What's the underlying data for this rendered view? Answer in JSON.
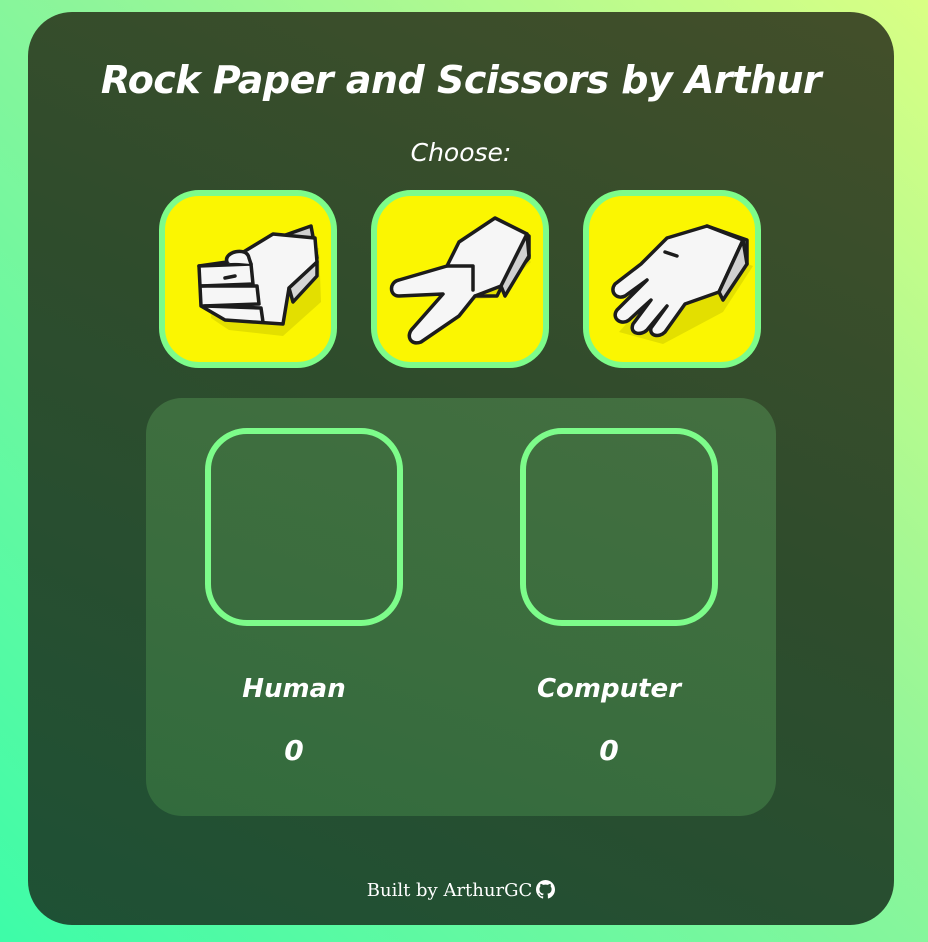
{
  "header": {
    "title": "Rock Paper and Scissors by Arthur",
    "prompt": "Choose:"
  },
  "choices": [
    {
      "id": "rock",
      "icon": "rock-hand-icon"
    },
    {
      "id": "scissors",
      "icon": "scissors-hand-icon"
    },
    {
      "id": "paper",
      "icon": "paper-hand-icon"
    }
  ],
  "players": {
    "human": {
      "label": "Human",
      "score": "0"
    },
    "computer": {
      "label": "Computer",
      "score": "0"
    }
  },
  "footer": {
    "text": "Built by ArthurGC",
    "icon": "github-icon"
  },
  "colors": {
    "accent_border": "#7dfc8a",
    "choice_bg": "#fbf601",
    "card_bg": "#2f4c2c",
    "arena_bg": "#3a6d3e"
  }
}
